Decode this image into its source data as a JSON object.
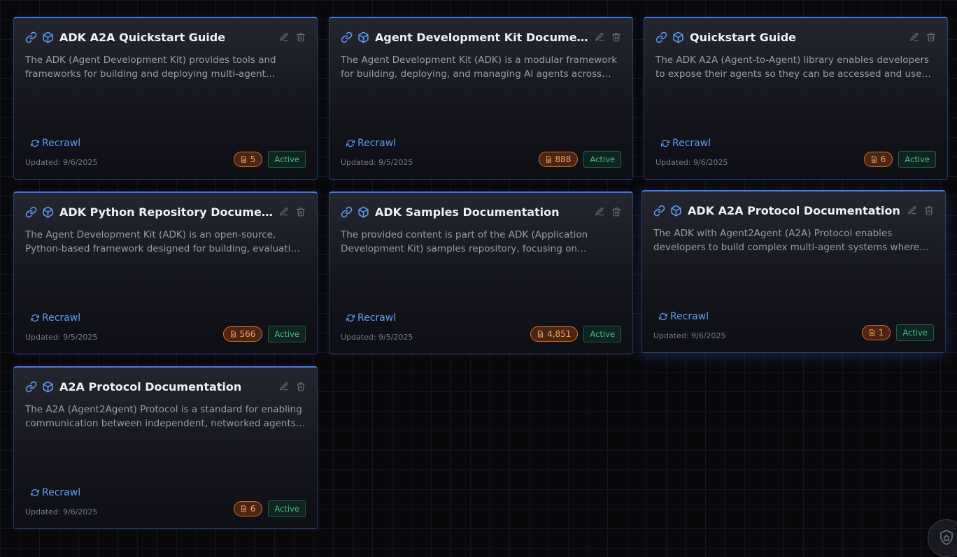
{
  "cards": [
    {
      "title": "ADK A2A Quickstart Guide",
      "description": "The ADK (Agent Development Kit) provides tools and frameworks for building and deploying multi-agent systems, with a focus on agent interoperability.",
      "recrawl_label": "Recrawl",
      "updated": "Updated: 9/6/2025",
      "doc_count": "5",
      "status": "Active"
    },
    {
      "title": "Agent Development Kit Documentation",
      "description": "The Agent Development Kit (ADK) is a modular framework for building, deploying, and managing AI agents across various environments.",
      "recrawl_label": "Recrawl",
      "updated": "Updated: 9/5/2025",
      "doc_count": "888",
      "status": "Active"
    },
    {
      "title": "Quickstart Guide",
      "description": "The ADK A2A (Agent-to-Agent) library enables developers to expose their agents so they can be accessed and used by other agents.",
      "recrawl_label": "Recrawl",
      "updated": "Updated: 9/6/2025",
      "doc_count": "6",
      "status": "Active"
    },
    {
      "title": "ADK Python Repository Documentation",
      "description": "The Agent Development Kit (ADK) is an open-source, Python-based framework designed for building, evaluating, and deploying agents.",
      "recrawl_label": "Recrawl",
      "updated": "Updated: 9/5/2025",
      "doc_count": "566",
      "status": "Active"
    },
    {
      "title": "ADK Samples Documentation",
      "description": "The provided content is part of the ADK (Application Development Kit) samples repository, focusing on supporting agent development.",
      "recrawl_label": "Recrawl",
      "updated": "Updated: 9/5/2025",
      "doc_count": "4,851",
      "status": "Active"
    },
    {
      "title": "ADK A2A Protocol Documentation",
      "description": "The ADK with Agent2Agent (A2A) Protocol enables developers to build complex multi-agent systems where agents can communicate.",
      "recrawl_label": "Recrawl",
      "updated": "Updated: 9/6/2025",
      "doc_count": "1",
      "status": "Active"
    },
    {
      "title": "A2A Protocol Documentation",
      "description": "The A2A (Agent2Agent) Protocol is a standard for enabling communication between independent, networked agents, regardless of framework.",
      "recrawl_label": "Recrawl",
      "updated": "Updated: 9/6/2025",
      "doc_count": "6",
      "status": "Active"
    }
  ],
  "icons": {
    "link": "link-icon",
    "source_type": "cube-icon",
    "edit": "pencil-icon",
    "delete": "trash-icon",
    "recrawl": "refresh-icon",
    "documents": "document-icon",
    "corner": "shield-icon"
  },
  "colors": {
    "accent_blue": "#3f7ae6",
    "count_badge_orange": "#f6a256",
    "status_green": "#3fc08a",
    "background": "#09090b"
  }
}
